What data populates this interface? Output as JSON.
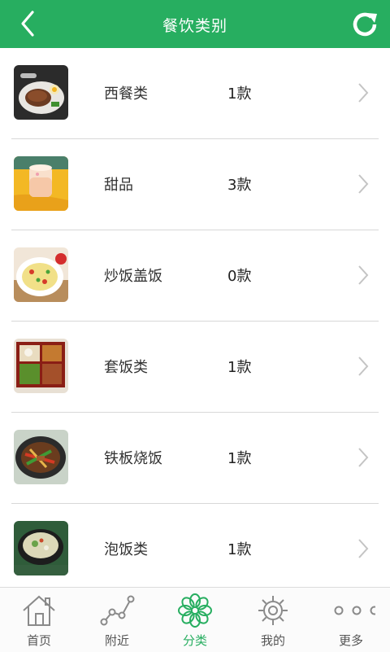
{
  "header": {
    "title": "餐饮类别",
    "back_icon": "chevron-left-icon",
    "refresh_icon": "refresh-icon",
    "bg_color": "#27ae60"
  },
  "categories": [
    {
      "name": "西餐类",
      "count": "1款",
      "thumb_icon": "steak-plate-thumbnail"
    },
    {
      "name": "甜品",
      "count": "3款",
      "thumb_icon": "pudding-jar-thumbnail"
    },
    {
      "name": "炒饭盖饭",
      "count": "0款",
      "thumb_icon": "fried-rice-thumbnail"
    },
    {
      "name": "套饭类",
      "count": "1款",
      "thumb_icon": "bento-box-thumbnail"
    },
    {
      "name": "铁板烧饭",
      "count": "1款",
      "thumb_icon": "teppanyaki-thumbnail"
    },
    {
      "name": "泡饭类",
      "count": "1款",
      "thumb_icon": "soup-rice-thumbnail"
    }
  ],
  "tabbar": {
    "items": [
      {
        "label": "首页",
        "icon": "home-icon"
      },
      {
        "label": "附近",
        "icon": "route-icon"
      },
      {
        "label": "分类",
        "icon": "category-flower-icon",
        "active": true
      },
      {
        "label": "我的",
        "icon": "gear-icon"
      },
      {
        "label": "更多",
        "icon": "more-dots-icon"
      }
    ],
    "active_color": "#27ae60"
  }
}
